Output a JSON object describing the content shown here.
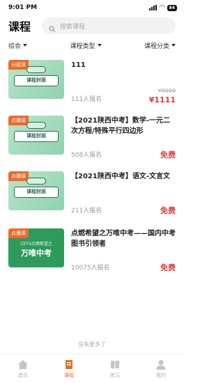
{
  "status": {
    "time": "9:01 PM",
    "battery": "84"
  },
  "header": {
    "title": "课程",
    "search_placeholder": "搜索课程"
  },
  "filters": [
    {
      "label": "综合"
    },
    {
      "label": "课程类型"
    },
    {
      "label": "课程分类"
    }
  ],
  "courses": [
    {
      "badge": "分组课",
      "thumb_text": "课程封面",
      "title": "111",
      "enrolled": "111人报名",
      "original_price": "¥9999",
      "price": "¥1111"
    },
    {
      "badge": "点播课",
      "thumb_text": "课程封面",
      "title": "【2021陕西中考】数学-一元二次方程/特殊平行四边形",
      "enrolled": "508人报名",
      "price": "免费"
    },
    {
      "badge": "点播课",
      "thumb_text": "课程封面",
      "title": "【2021陕西中考】语文-文言文",
      "enrolled": "211人报名",
      "price": "免费"
    },
    {
      "badge": "点播课",
      "thumb_top": "CETV点燃希望之",
      "thumb_main": "万唯中考",
      "title": "点燃希望之万唯中考——国内中考图书引领者",
      "enrolled": "10075人报名",
      "price": "免费"
    }
  ],
  "footer_text": "没有更多了",
  "tabbar": [
    {
      "label": "首页"
    },
    {
      "label": "课程"
    },
    {
      "label": "练习"
    },
    {
      "label": "我的"
    }
  ],
  "colors": {
    "accent": "#ee6a2a",
    "price": "#e23c3c",
    "thumb_green": "#2e9b5d"
  }
}
